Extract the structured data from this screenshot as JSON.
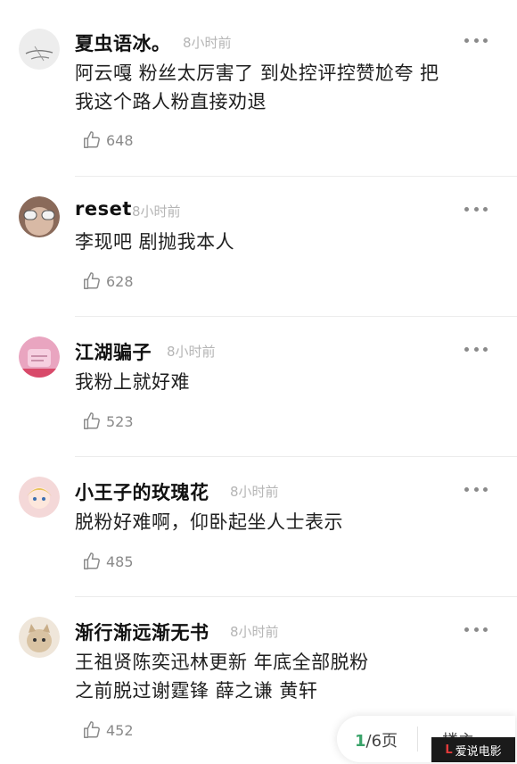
{
  "comments": [
    {
      "user": "夏虫语冰。",
      "time": "8小时前",
      "text": "阿云嘎 粉丝太厉害了 到处控评控赞尬夸 把\n我这个路人粉直接劝退",
      "likes": "648"
    },
    {
      "user": "reset",
      "time": "8小时前",
      "text": "李现吧 剧抛我本人",
      "likes": "628"
    },
    {
      "user": "江湖骗子",
      "time": "8小时前",
      "text": "我粉上就好难",
      "likes": "523"
    },
    {
      "user": "小王子的玫瑰花",
      "time": "8小时前",
      "text": "脱粉好难啊，仰卧起坐人士表示",
      "likes": "485"
    },
    {
      "user": "渐行渐远渐无书",
      "time": "8小时前",
      "text": "王祖贤陈奕迅林更新 年底全部脱粉\n之前脱过谢霆锋 薛之谦 黄轩",
      "likes": "452"
    }
  ],
  "pager": {
    "current": "1",
    "rest": "/6页",
    "button": "楼主"
  },
  "watermark": {
    "text": "爱说电影"
  },
  "colors": {
    "accent": "#3aa36a",
    "time": "#b5b5b5",
    "icon": "#8a8a8a"
  }
}
